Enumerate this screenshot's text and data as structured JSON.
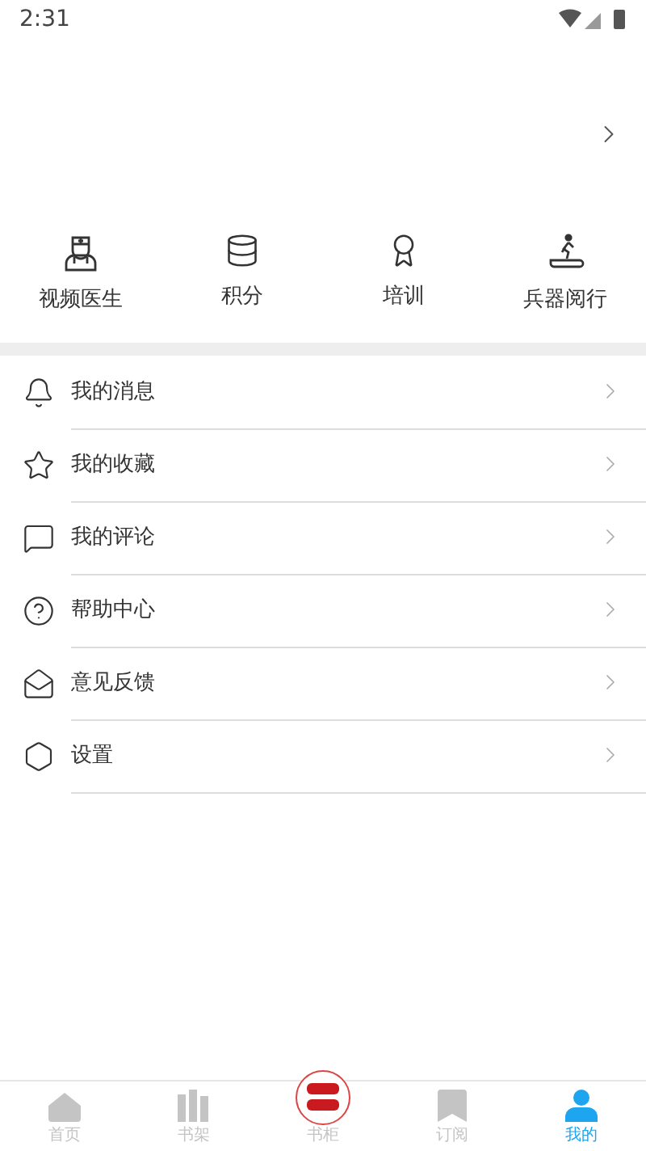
{
  "status_bar": {
    "time": "2:31"
  },
  "shortcuts": [
    {
      "label": "视频医生",
      "kind": "doctor"
    },
    {
      "label": "积分",
      "kind": "coins"
    },
    {
      "label": "培训",
      "kind": "award"
    },
    {
      "label": "兵器阅行",
      "kind": "walker"
    }
  ],
  "menu": [
    {
      "label": "我的消息",
      "kind": "bell"
    },
    {
      "label": "我的收藏",
      "kind": "star"
    },
    {
      "label": "我的评论",
      "kind": "comment"
    },
    {
      "label": "帮助中心",
      "kind": "help"
    },
    {
      "label": "意见反馈",
      "kind": "feedback"
    },
    {
      "label": "设置",
      "kind": "settings"
    }
  ],
  "tabs": [
    {
      "label": "首页",
      "kind": "home",
      "selected": false
    },
    {
      "label": "书架",
      "kind": "shelf",
      "selected": false
    },
    {
      "label": "书柜",
      "kind": "logo",
      "selected": false
    },
    {
      "label": "订阅",
      "kind": "bookmark",
      "selected": false
    },
    {
      "label": "我的",
      "kind": "user",
      "selected": true
    }
  ]
}
